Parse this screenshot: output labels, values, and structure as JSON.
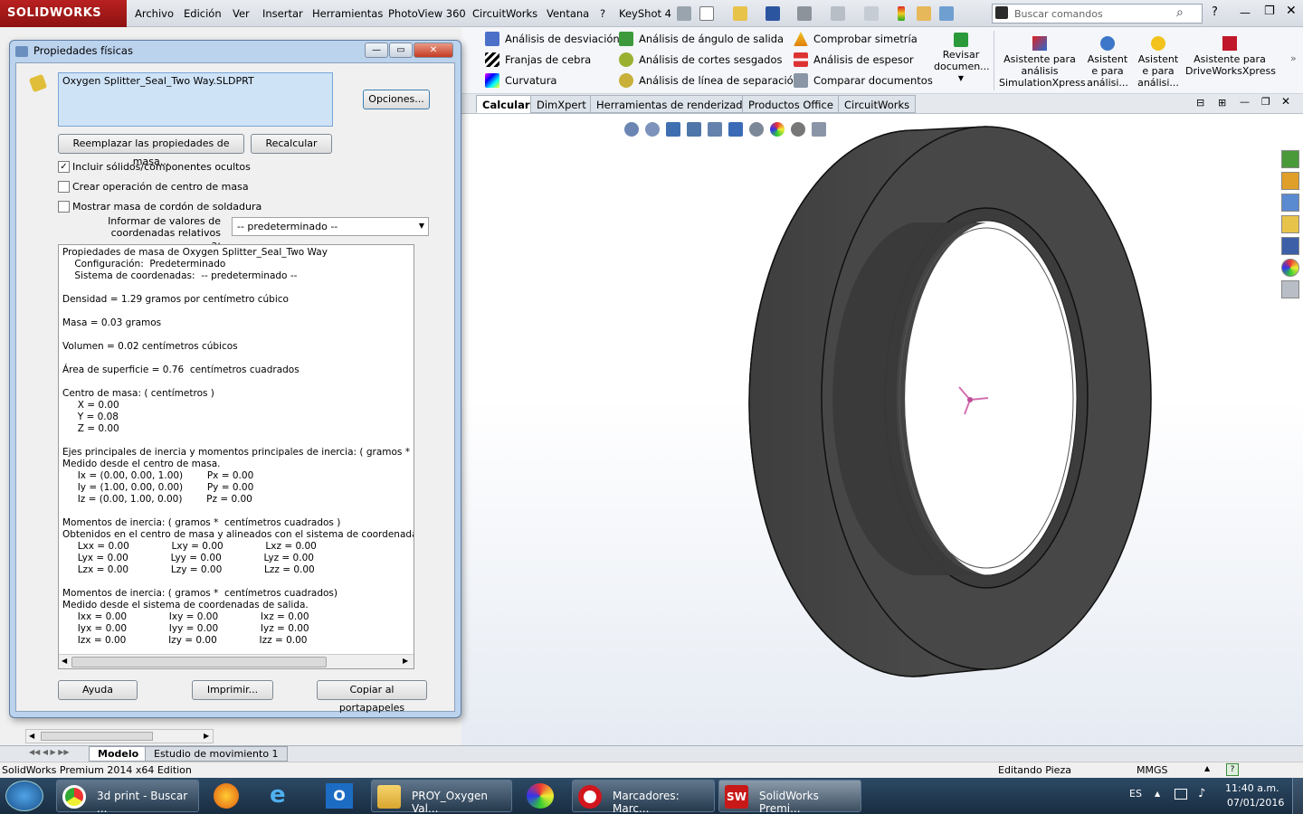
{
  "app": {
    "logo": "SOLIDWORKS"
  },
  "menu": [
    "Archivo",
    "Edición",
    "Ver",
    "Insertar",
    "Herramientas",
    "PhotoView 360",
    "CircuitWorks",
    "Ventana",
    "?",
    "KeyShot 4"
  ],
  "search": {
    "placeholder": "Buscar comandos"
  },
  "cmd": {
    "col1": [
      "Análisis de desviación",
      "Franjas de cebra",
      "Curvatura"
    ],
    "col2": [
      "Análisis de ángulo de salida",
      "Análisis de cortes sesgados",
      "Análisis de línea de separación"
    ],
    "col3": [
      "Comprobar simetría",
      "Análisis de espesor",
      "Comparar documentos"
    ],
    "revisar": "Revisar documen...",
    "big": [
      "Asistente para análisis SimulationXpress",
      "Asistent e para análisi...",
      "Asistent e para análisi...",
      "Asistente para DriveWorksXpress"
    ]
  },
  "tabs": [
    "Calcular",
    "DimXpert",
    "Herramientas de renderizado",
    "Productos Office",
    "CircuitWorks"
  ],
  "dialog": {
    "title": "Propiedades físicas",
    "file": "Oxygen Splitter_Seal_Two Way.SLDPRT",
    "options_btn": "Opciones...",
    "replace_btn": "Reemplazar las propiedades de masa...",
    "recalc_btn": "Recalcular",
    "chk_hidden": "Incluir sólidos/componentes ocultos",
    "chk_center": "Crear operación de centro de masa",
    "chk_weld": "Mostrar masa de cordón de soldadura",
    "coord_label": "Informar de valores de coordenadas relativos a:",
    "coord_value": "-- predeterminado --",
    "help_btn": "Ayuda",
    "print_btn": "Imprimir...",
    "copy_btn": "Copiar al portapapeles",
    "results": [
      "Propiedades de masa de Oxygen Splitter_Seal_Two Way",
      "    Configuración:  Predeterminado",
      "    Sistema de coordenadas:  -- predeterminado --",
      "",
      "Densidad = 1.29 gramos por centímetro cúbico",
      "",
      "Masa = 0.03 gramos",
      "",
      "Volumen = 0.02 centímetros cúbicos",
      "",
      "Área de superficie = 0.76  centímetros cuadrados",
      "",
      "Centro de masa: ( centímetros )",
      "     X = 0.00",
      "     Y = 0.08",
      "     Z = 0.00",
      "",
      "Ejes principales de inercia y momentos principales de inercia: ( gramos *  cen",
      "Medido desde el centro de masa.",
      "     Ix = (0.00, 0.00, 1.00)        Px = 0.00",
      "     Iy = (1.00, 0.00, 0.00)        Py = 0.00",
      "     Iz = (0.00, 1.00, 0.00)        Pz = 0.00",
      "",
      "Momentos de inercia: ( gramos *  centímetros cuadrados )",
      "Obtenidos en el centro de masa y alineados con el sistema de coordenadas",
      "     Lxx = 0.00              Lxy = 0.00              Lxz = 0.00",
      "     Lyx = 0.00              Lyy = 0.00              Lyz = 0.00",
      "     Lzx = 0.00              Lzy = 0.00              Lzz = 0.00",
      "",
      "Momentos de inercia: ( gramos *  centímetros cuadrados)",
      "Medido desde el sistema de coordenadas de salida.",
      "     Ixx = 0.00              Ixy = 0.00              Ixz = 0.00",
      "     Iyx = 0.00              Iyy = 0.00              Iyz = 0.00",
      "     Izx = 0.00              Izy = 0.00              Izz = 0.00"
    ]
  },
  "bottom_tabs": [
    "Modelo",
    "Estudio de movimiento 1"
  ],
  "status": {
    "left": "SolidWorks Premium 2014 x64 Edition",
    "mid": "Editando Pieza",
    "units": "MMGS"
  },
  "taskbar": {
    "items": [
      "3d print - Buscar ...",
      "PROY_Oxygen Val...",
      "Marcadores: Marc...",
      "SolidWorks Premi..."
    ],
    "lang": "ES",
    "time": "11:40 a.m.",
    "date": "07/01/2016"
  }
}
